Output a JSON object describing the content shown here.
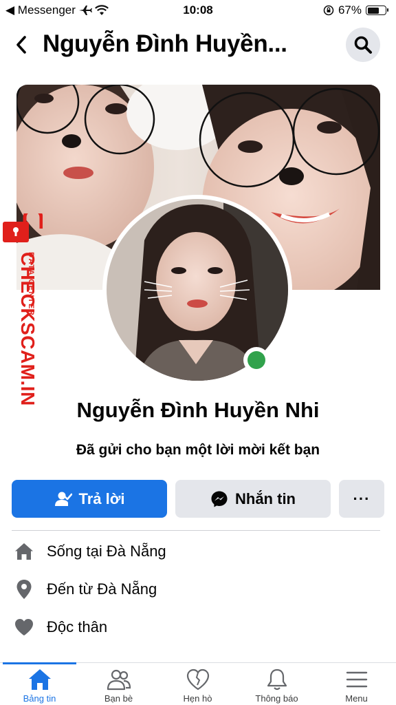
{
  "status_bar": {
    "back_app": "◀ Messenger",
    "time": "10:08",
    "battery": "67%",
    "battery_level": 0.67
  },
  "header": {
    "title": "Nguyễn Đình Huyền..."
  },
  "profile": {
    "name": "Nguyễn Đình Huyền Nhi",
    "request_text": "Đã gửi cho bạn một lời mời kết bạn",
    "online": true
  },
  "actions": {
    "reply_label": "Trả lời",
    "message_label": "Nhắn tin",
    "more_label": "···"
  },
  "details": [
    {
      "icon": "home-icon",
      "text": "Sống tại Đà Nẵng"
    },
    {
      "icon": "location-pin-icon",
      "text": "Đến từ Đà Nẵng"
    },
    {
      "icon": "heart-icon",
      "text": "Độc thân"
    }
  ],
  "watermark": {
    "brand": "CHECKSCAM.INFO",
    "tag": "DATA CENTER"
  },
  "nav": {
    "items": [
      {
        "label": "Bảng tin",
        "active": true
      },
      {
        "label": "Bạn bè"
      },
      {
        "label": "Hẹn hò"
      },
      {
        "label": "Thông báo"
      },
      {
        "label": "Menu"
      }
    ]
  },
  "colors": {
    "accent": "#1b74e4",
    "online": "#31a24c",
    "button_gray": "#e4e6eb",
    "watermark_red": "#e0201b"
  }
}
